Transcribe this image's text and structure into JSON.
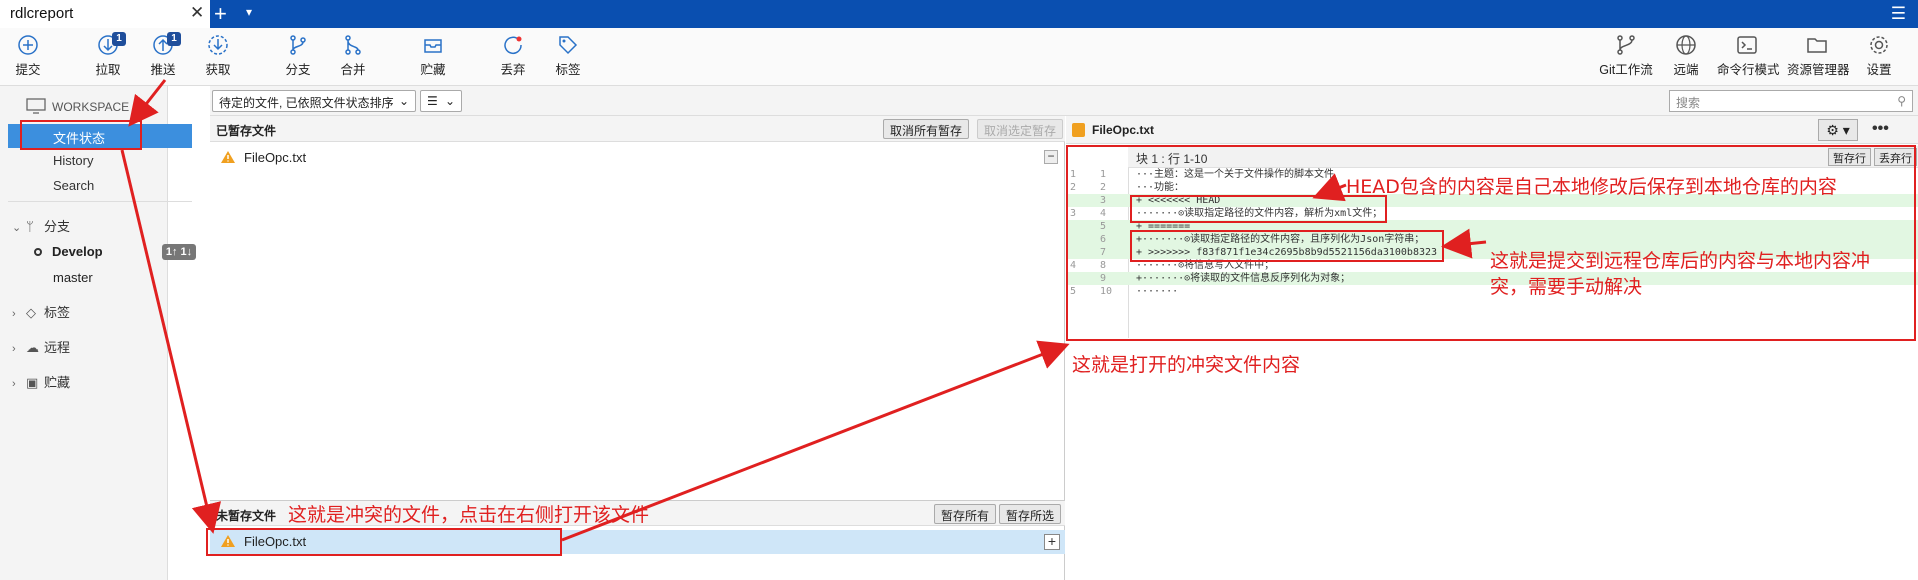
{
  "tab": {
    "title": "rdlcreport",
    "close": "✕",
    "new_tab": "+",
    "tab_menu": "▾",
    "menu": "☰"
  },
  "toolbar": {
    "commit": "提交",
    "pull": "拉取",
    "pull_badge": "1",
    "push": "推送",
    "push_badge": "1",
    "fetch": "获取",
    "branch": "分支",
    "merge": "合并",
    "stash": "贮藏",
    "discard": "丢弃",
    "tag": "标签",
    "gitflow": "Git工作流",
    "remote": "远端",
    "terminal": "命令行模式",
    "explorer": "资源管理器",
    "settings": "设置"
  },
  "sidebar": {
    "workspace": "WORKSPACE",
    "file_status": "文件状态",
    "history": "History",
    "search": "Search",
    "branches_group": "分支",
    "branches": [
      "Develop",
      "master"
    ],
    "sync_badge": "1↑ 1↓",
    "tags_group": "标签",
    "remote_group": "远程",
    "stash_group": "贮藏"
  },
  "filter": {
    "sort_select": "待定的文件, 已依照文件状态排序",
    "view_select": "☰",
    "search_placeholder": "搜索"
  },
  "staged": {
    "title": "已暂存文件",
    "unstage_all": "取消所有暂存",
    "unstage_selected": "取消选定暂存",
    "files": [
      "FileOpc.txt"
    ],
    "minus": "−"
  },
  "unstaged": {
    "title": "未暂存文件",
    "stage_all": "暂存所有",
    "stage_selected": "暂存所选",
    "files": [
      "FileOpc.txt"
    ],
    "plus": "+"
  },
  "diff": {
    "filename": "FileOpc.txt",
    "gear": "⚙ ▾",
    "more": "•••",
    "hunk_title": "块 1 : 行 1-10",
    "stage_lines": "暂存行",
    "discard_lines": "丢弃行",
    "lines": [
      {
        "old": "1",
        "new": "1",
        "text": "···主题：这是一个关于文件操作的脚本文件",
        "add": false
      },
      {
        "old": "2",
        "new": "2",
        "text": "···功能：",
        "add": false
      },
      {
        "old": "",
        "new": "3",
        "text": "+ <<<<<<< HEAD",
        "add": true
      },
      {
        "old": "3",
        "new": "4",
        "text": "·······⊙读取指定路径的文件内容，解析为xml文件；",
        "add": false
      },
      {
        "old": "",
        "new": "5",
        "text": "+ =======",
        "add": true
      },
      {
        "old": "",
        "new": "6",
        "text": "+·······⊙读取指定路径的文件内容，且序列化为Json字符串；",
        "add": true
      },
      {
        "old": "",
        "new": "7",
        "text": "+ >>>>>>> f83f871f1e34c2695b8b9d5521156da3100b8323",
        "add": true
      },
      {
        "old": "4",
        "new": "8",
        "text": "·······⊙将信息写入文件中；",
        "add": false
      },
      {
        "old": "",
        "new": "9",
        "text": "+·······⊙将读取的文件信息反序列化为对象；",
        "add": true
      },
      {
        "old": "5",
        "new": "10",
        "text": "·······",
        "add": false
      }
    ]
  },
  "annotations": {
    "head_note": "HEAD包含的内容是自己本地修改后保存到本地仓库的内容",
    "remote_note_1": "这就是提交到远程仓库后的内容与本地内容冲",
    "remote_note_2": "突，需要手动解决",
    "opened_note": "这就是打开的冲突文件内容",
    "conflict_note": "这就是冲突的文件，点击在右侧打开该文件"
  }
}
